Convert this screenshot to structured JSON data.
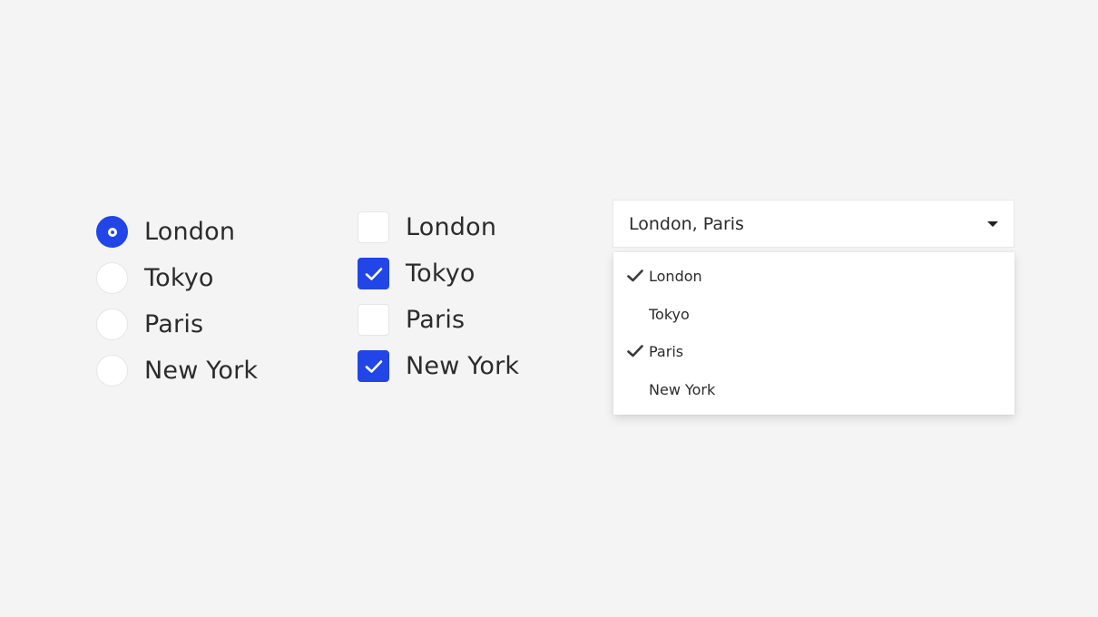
{
  "radio_group": {
    "options": [
      {
        "label": "London",
        "selected": true
      },
      {
        "label": "Tokyo",
        "selected": false
      },
      {
        "label": "Paris",
        "selected": false
      },
      {
        "label": "New York",
        "selected": false
      }
    ]
  },
  "checkbox_group": {
    "options": [
      {
        "label": "London",
        "checked": false
      },
      {
        "label": "Tokyo",
        "checked": true
      },
      {
        "label": "Paris",
        "checked": false
      },
      {
        "label": "New York",
        "checked": true
      }
    ]
  },
  "multiselect": {
    "value": "London, Paris",
    "options": [
      {
        "label": "London",
        "checked": true
      },
      {
        "label": "Tokyo",
        "checked": false
      },
      {
        "label": "Paris",
        "checked": true
      },
      {
        "label": "New York",
        "checked": false
      }
    ]
  },
  "colors": {
    "accent": "#2145e6",
    "background": "#f4f4f4",
    "text": "#2b2b2b"
  }
}
